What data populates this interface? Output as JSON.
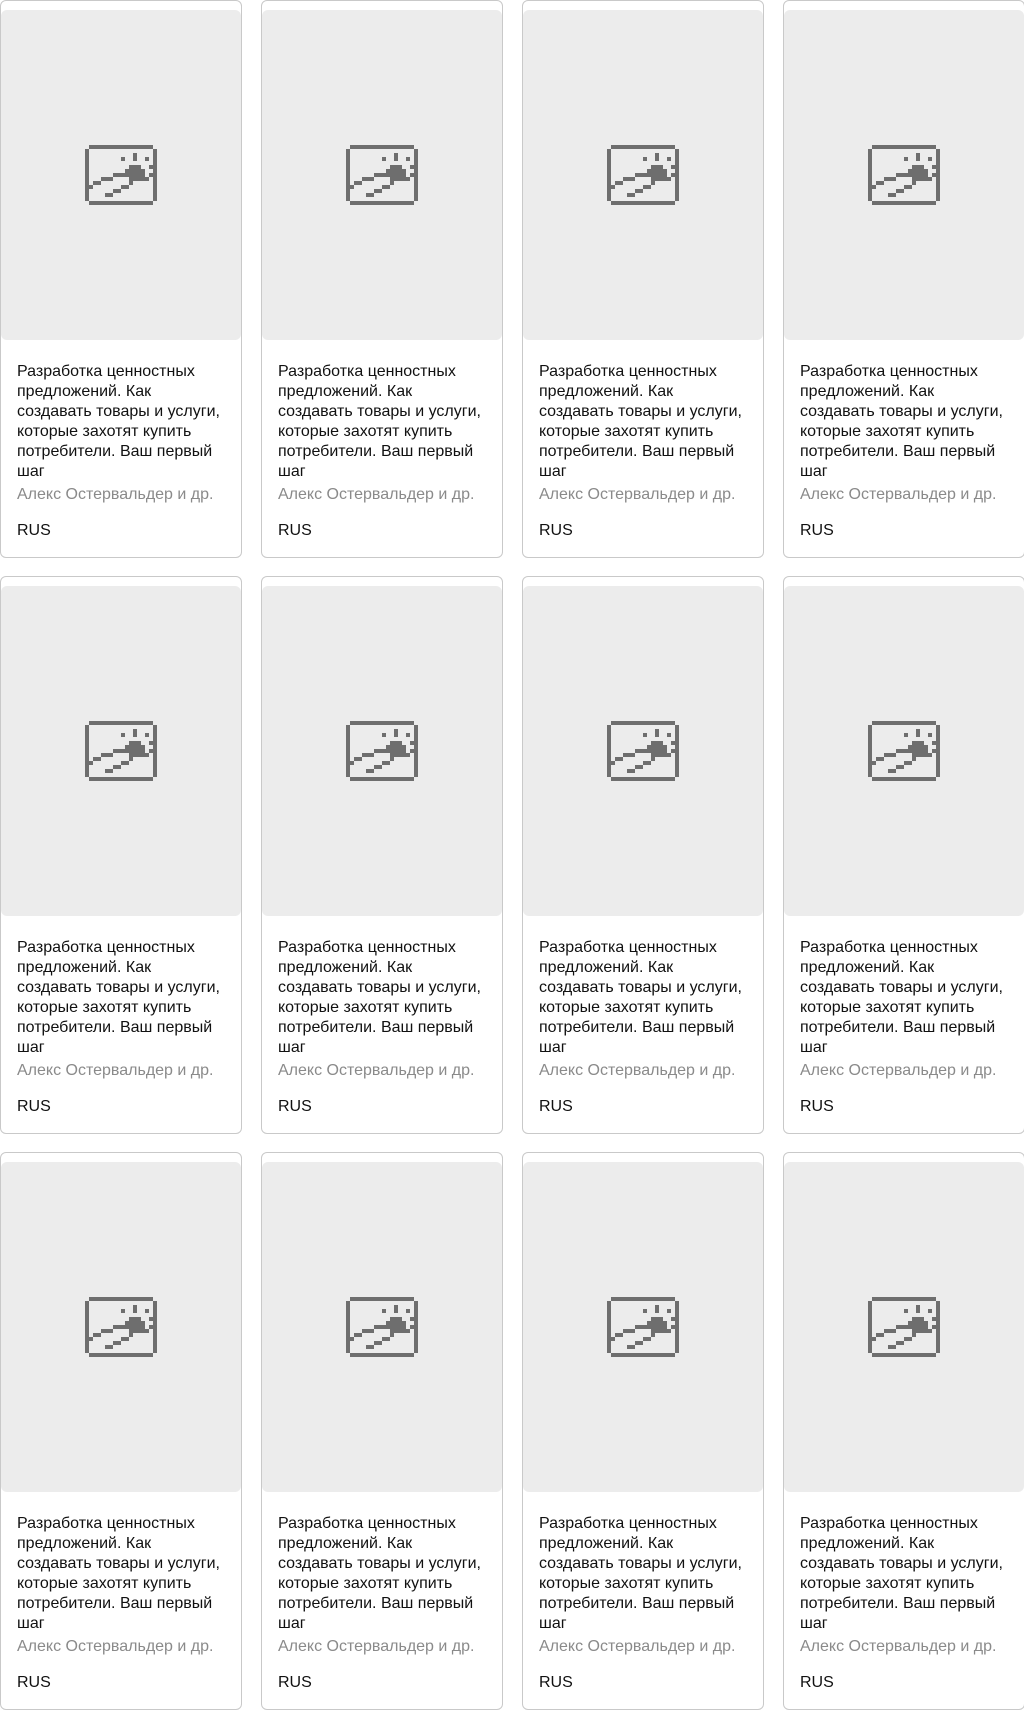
{
  "books": [
    {
      "title": "Разработка ценностных предложений. Как создавать товары и услуги, которые захотят купить потребители. Ваш первый шаг",
      "author": "Алекс Остервальдер и др.",
      "language": "RUS",
      "cover_icon": "image-placeholder-icon"
    },
    {
      "title": "Разработка ценностных предложений. Как создавать товары и услуги, которые захотят купить потребители. Ваш первый шаг",
      "author": "Алекс Остервальдер и др.",
      "language": "RUS",
      "cover_icon": "image-placeholder-icon"
    },
    {
      "title": "Разработка ценностных предложений. Как создавать товары и услуги, которые захотят купить потребители. Ваш первый шаг",
      "author": "Алекс Остервальдер и др.",
      "language": "RUS",
      "cover_icon": "image-placeholder-icon"
    },
    {
      "title": "Разработка ценностных предложений. Как создавать товары и услуги, которые захотят купить потребители. Ваш первый шаг",
      "author": "Алекс Остервальдер и др.",
      "language": "RUS",
      "cover_icon": "image-placeholder-icon"
    },
    {
      "title": "Разработка ценностных предложений. Как создавать товары и услуги, которые захотят купить потребители. Ваш первый шаг",
      "author": "Алекс Остервальдер и др.",
      "language": "RUS",
      "cover_icon": "image-placeholder-icon"
    },
    {
      "title": "Разработка ценностных предложений. Как создавать товары и услуги, которые захотят купить потребители. Ваш первый шаг",
      "author": "Алекс Остервальдер и др.",
      "language": "RUS",
      "cover_icon": "image-placeholder-icon"
    },
    {
      "title": "Разработка ценностных предложений. Как создавать товары и услуги, которые захотят купить потребители. Ваш первый шаг",
      "author": "Алекс Остервальдер и др.",
      "language": "RUS",
      "cover_icon": "image-placeholder-icon"
    },
    {
      "title": "Разработка ценностных предложений. Как создавать товары и услуги, которые захотят купить потребители. Ваш первый шаг",
      "author": "Алекс Остервальдер и др.",
      "language": "RUS",
      "cover_icon": "image-placeholder-icon"
    },
    {
      "title": "Разработка ценностных предложений. Как создавать товары и услуги, которые захотят купить потребители. Ваш первый шаг",
      "author": "Алекс Остервальдер и др.",
      "language": "RUS",
      "cover_icon": "image-placeholder-icon"
    },
    {
      "title": "Разработка ценностных предложений. Как создавать товары и услуги, которые захотят купить потребители. Ваш первый шаг",
      "author": "Алекс Остервальдер и др.",
      "language": "RUS",
      "cover_icon": "image-placeholder-icon"
    },
    {
      "title": "Разработка ценностных предложений. Как создавать товары и услуги, которые захотят купить потребители. Ваш первый шаг",
      "author": "Алекс Остервальдер и др.",
      "language": "RUS",
      "cover_icon": "image-placeholder-icon"
    },
    {
      "title": "Разработка ценностных предложений. Как создавать товары и услуги, которые захотят купить потребители. Ваш первый шаг",
      "author": "Алекс Остервальдер и др.",
      "language": "RUS",
      "cover_icon": "image-placeholder-icon"
    }
  ],
  "colors": {
    "cover_background": "#ececec",
    "card_border": "#c9c9c9",
    "author_text": "#8a8a8a",
    "icon": "#6e6e6e"
  }
}
